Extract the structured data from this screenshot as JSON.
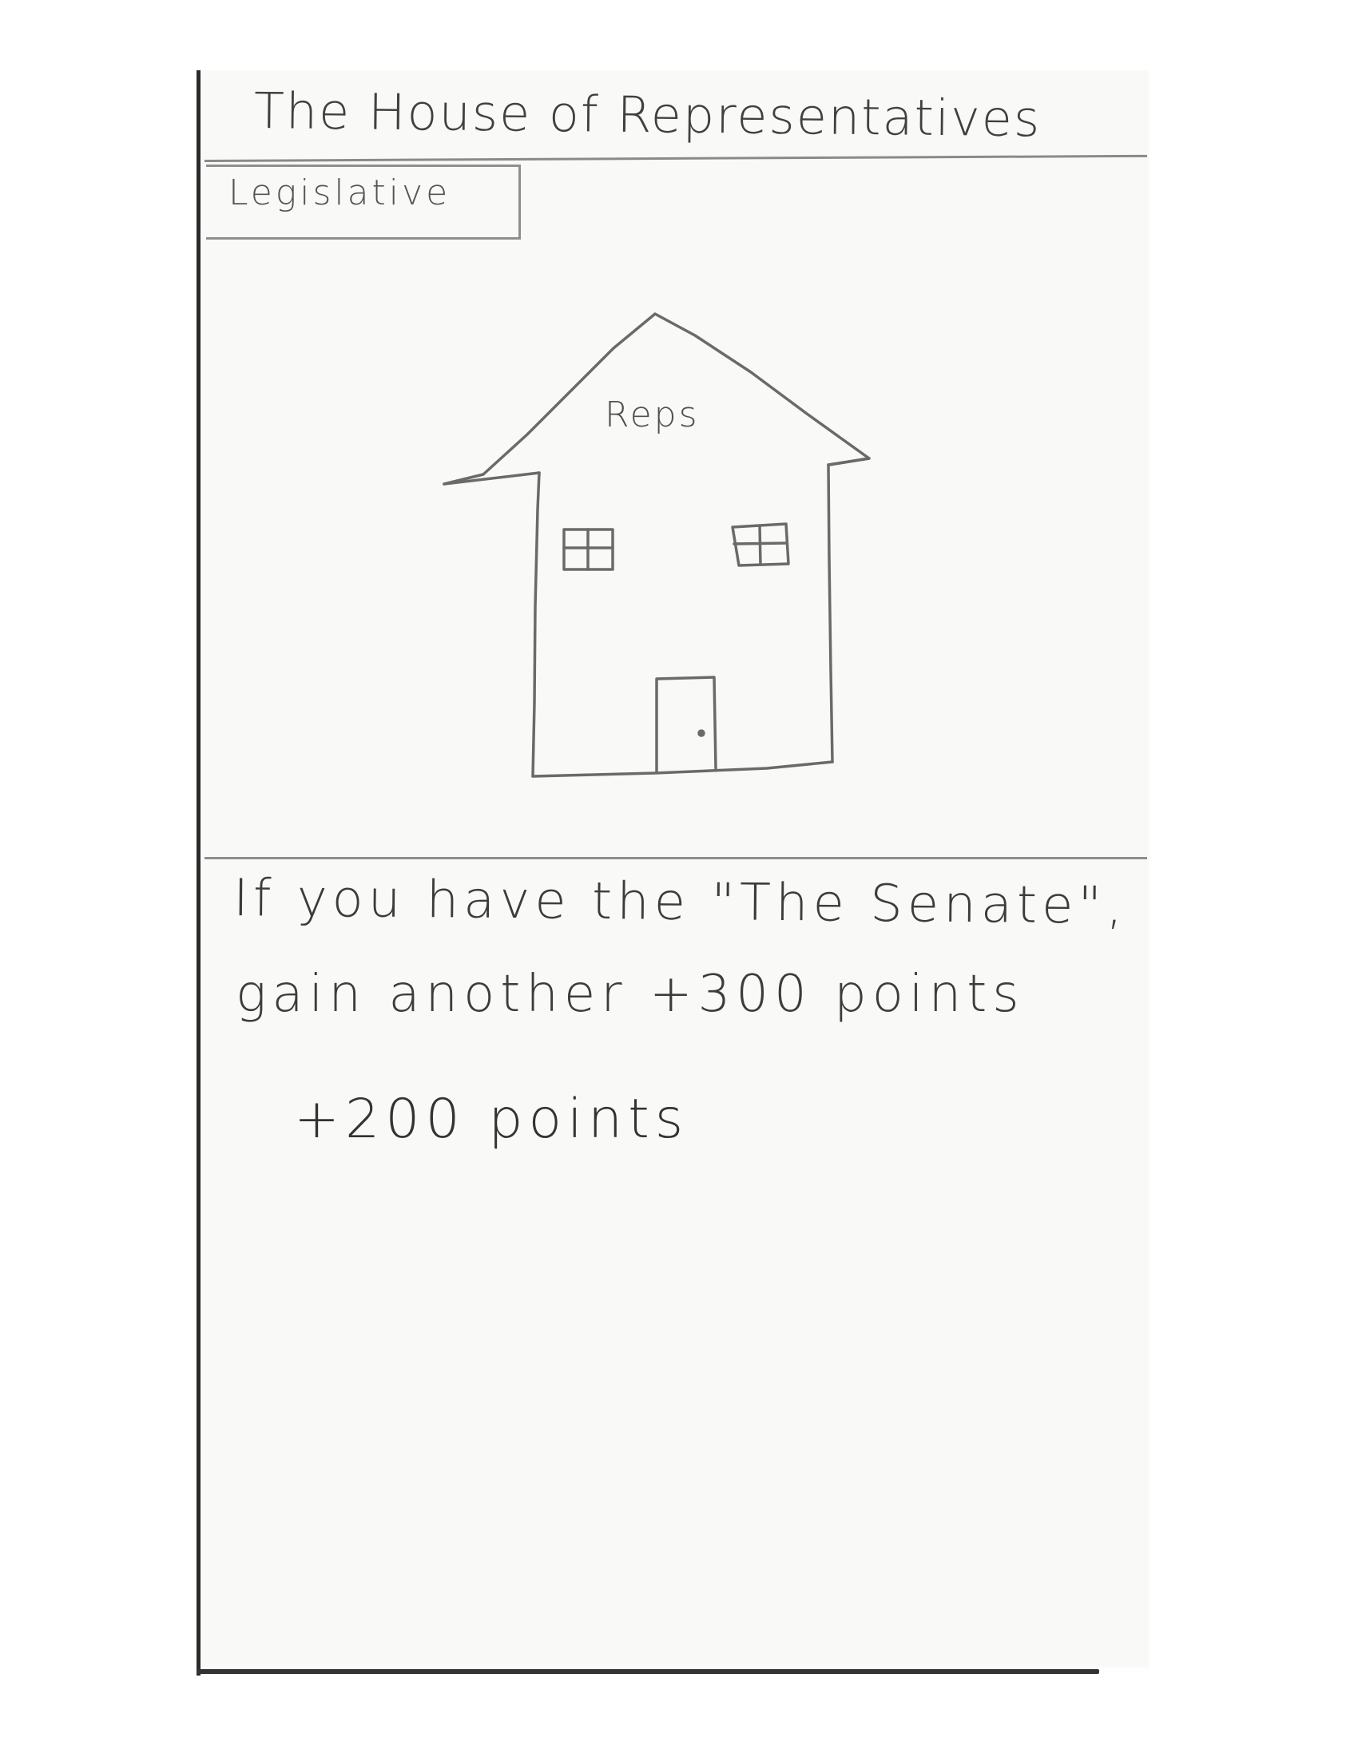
{
  "card": {
    "title": "The House of Representatives",
    "tag": "Legislative",
    "illustration": {
      "subject": "house-icon",
      "label": "Reps"
    },
    "rule_text": {
      "line1": "If you have the \"The Senate\",",
      "line2": "gain another +300 points"
    },
    "points": "+200 points"
  },
  "colors": {
    "paper": "#f9f9f8",
    "pencil": "#3a3a3a",
    "rule": "#8e8e8e"
  }
}
